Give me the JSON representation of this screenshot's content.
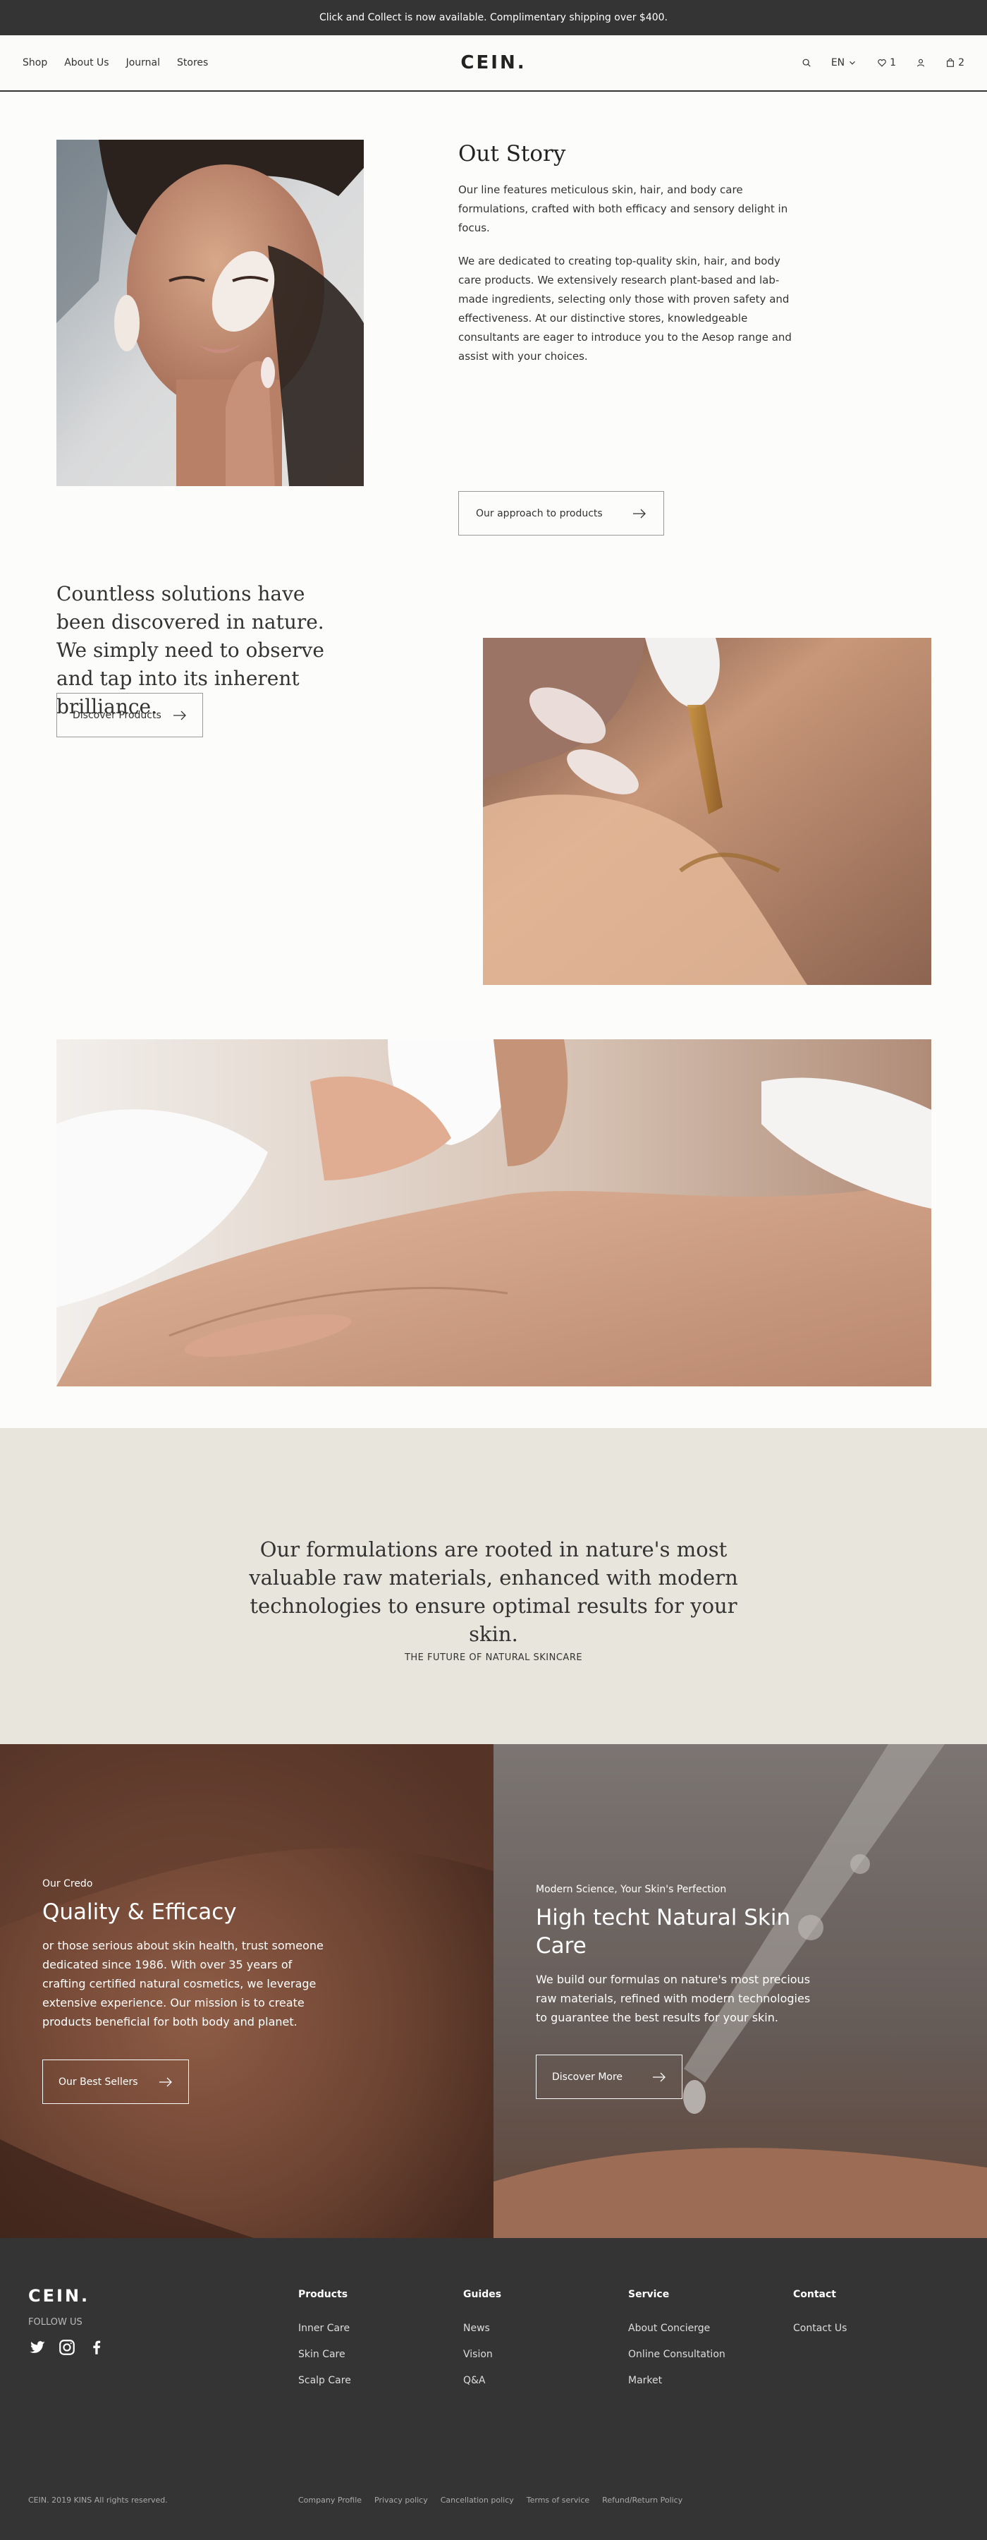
{
  "announcement": "Click and Collect is now available. Complimentary shipping over $400.",
  "header": {
    "nav": [
      "Shop",
      "About Us",
      "Journal",
      "Stores"
    ],
    "logo": "CEIN.",
    "language": "EN",
    "wishlist_count": "1",
    "cart_count": "2"
  },
  "story": {
    "title": "Out Story",
    "p1": "Our line features meticulous skin, hair, and body care formulations, crafted with both efficacy and sensory delight in focus.",
    "p2": "We are dedicated to creating top-quality skin, hair, and body care products. We extensively research plant-based and lab-made ingredients, selecting only those with proven safety and effectiveness. At our distinctive stores, knowledgeable consultants are eager to introduce you to the Aesop range and assist with your choices.",
    "button": "Our approach to products"
  },
  "solutions": {
    "quote": "Countless solutions have been discovered in nature. We simply need to observe and tap into its inherent brilliance.",
    "button": "Discover Products"
  },
  "mission": {
    "quote": "Our formulations are rooted in nature's most valuable raw materials, enhanced with modern technologies to ensure optimal results for your skin.",
    "subtitle": "THE FUTURE OF NATURAL SKINCARE"
  },
  "promo_left": {
    "eyebrow": "Our Credo",
    "title": "Quality & Efficacy",
    "body": "or those serious about skin health, trust someone dedicated since 1986. With over 35 years of crafting certified natural cosmetics, we leverage extensive experience. Our mission is to create products beneficial for both body and planet.",
    "button": "Our Best Sellers"
  },
  "promo_right": {
    "eyebrow": "Modern Science, Your Skin's Perfection",
    "title": "High techt Natural Skin Care",
    "body": "We build our formulas on nature's most precious raw materials, refined with modern technologies to guarantee the best results for your skin.",
    "button": "Discover More"
  },
  "footer": {
    "logo": "CEIN.",
    "follow": "FOLLOW US",
    "social_icons": [
      "twitter-icon",
      "instagram-icon",
      "facebook-icon"
    ],
    "columns": [
      {
        "title": "Products",
        "items": [
          "Inner Care",
          "Skin Care",
          "Scalp Care"
        ]
      },
      {
        "title": "Guides",
        "items": [
          "News",
          "Vision",
          "Q&A"
        ]
      },
      {
        "title": "Service",
        "items": [
          "About Concierge",
          "Online Consultation",
          "Market"
        ]
      },
      {
        "title": "Contact",
        "items": [
          "Contact Us"
        ]
      }
    ],
    "copyright": "CEIN. 2019 KINS All rights reserved.",
    "legal": [
      "Company Profile",
      "Privacy policy",
      "Cancellation policy",
      "Terms of service",
      "Refund/Return Policy"
    ]
  },
  "colors": {
    "dark": "#343434",
    "background": "#fcfdfa",
    "mission_bg": "#e8e6dc"
  }
}
